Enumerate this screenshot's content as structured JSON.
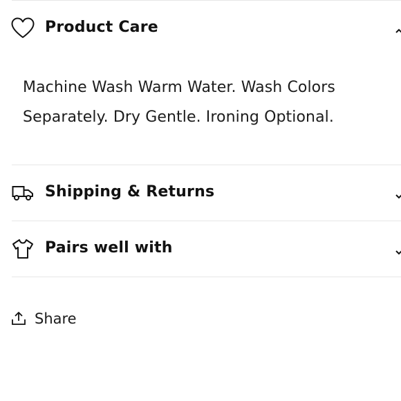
{
  "accordions": {
    "product_care": {
      "title": "Product Care",
      "icon": "heart-icon",
      "expanded": true,
      "content": "Machine Wash Warm Water. Wash Colors Separately. Dry Gentle. Ironing Optional."
    },
    "shipping": {
      "title": "Shipping & Returns",
      "icon": "truck-icon",
      "expanded": false
    },
    "pairs": {
      "title": "Pairs well with",
      "icon": "shirt-icon",
      "expanded": false
    }
  },
  "share": {
    "label": "Share",
    "icon": "share-icon"
  },
  "colors": {
    "text": "#121212",
    "divider": "#e6e6e6"
  }
}
